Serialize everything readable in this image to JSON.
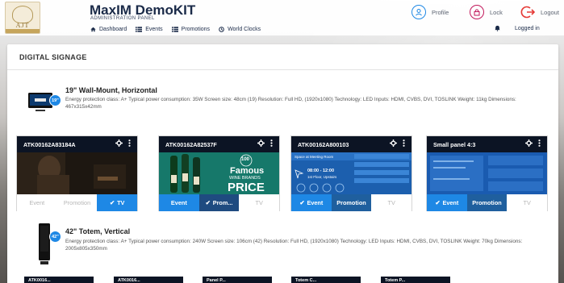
{
  "header": {
    "title": "MaxIM DemoKIT",
    "subtitle": "ADMINISTRATION PANEL",
    "logo_letters": "AJT",
    "nav": [
      {
        "label": "Dashboard",
        "icon": "home-icon"
      },
      {
        "label": "Events",
        "icon": "list-icon"
      },
      {
        "label": "Promotions",
        "icon": "list-icon"
      },
      {
        "label": "World Clocks",
        "icon": "clock-icon"
      }
    ],
    "profile_label": "Profile",
    "lock_label": "Lock",
    "logout_label": "Logout",
    "logged_label": "Logged in"
  },
  "panel": {
    "title": "DIGITAL SIGNAGE"
  },
  "groups": [
    {
      "title": "19\" Wall-Mount, Horizontal",
      "badge": "19\"",
      "description": "Energy protection class: A+ Typical power consumption: 35W Screen size: 48cm (19) Resolution: Full HD, (1920x1080) Technology: LED Inputs: HDMI, CVBS, DVI, TOSLINK Weight: 11kg Dimensions: 467x315x42mm"
    },
    {
      "title": "42\" Totem, Vertical",
      "badge": "42\"",
      "description": "Energy protection class: A+ Typical power consumption: 240W Screen size: 106cm (42) Resolution: Full HD, (1920x1080) Technology: LED Inputs: HDMI, CVBS, DVI, TOSLINK Weight: 70kg Dimensions: 2005x805x350mm"
    }
  ],
  "cards": [
    {
      "name": "ATK00162A83184A",
      "buttons": [
        {
          "label": "Event",
          "active": false
        },
        {
          "label": "Promotion",
          "active": false
        },
        {
          "label": "TV",
          "active": true
        }
      ]
    },
    {
      "name": "ATK00162A82537F",
      "promo_text": {
        "big": "Famous",
        "mid": "WINE BRANDS",
        "price": "PRICE",
        "seal": "100"
      },
      "buttons": [
        {
          "label": "Event",
          "active": true
        },
        {
          "label": "Prom...",
          "active": true
        },
        {
          "label": "TV",
          "active": false
        }
      ]
    },
    {
      "name": "ATK00162A800103",
      "screen_text": {
        "room": "Space at Meeting Room",
        "time": "08:00 - 12:00",
        "place": "1st Floor, Upstairs"
      },
      "buttons": [
        {
          "label": "Event",
          "active": true
        },
        {
          "label": "Promotion",
          "active": true
        },
        {
          "label": "TV",
          "active": false
        }
      ]
    },
    {
      "name": "Small panel 4:3",
      "buttons": [
        {
          "label": "Event",
          "active": true
        },
        {
          "label": "Promotion",
          "active": true
        },
        {
          "label": "TV",
          "active": false
        }
      ]
    }
  ],
  "bottom_cards": [
    "ATK0016...",
    "ATK0016...",
    "Panel P...",
    "Totem C...",
    "Totem P..."
  ],
  "colors": {
    "accent": "#1e88e5",
    "header_dark": "#0c1424",
    "logout_red": "#e53935",
    "lock_magenta": "#c2185b",
    "profile_blue": "#1e88e5"
  }
}
